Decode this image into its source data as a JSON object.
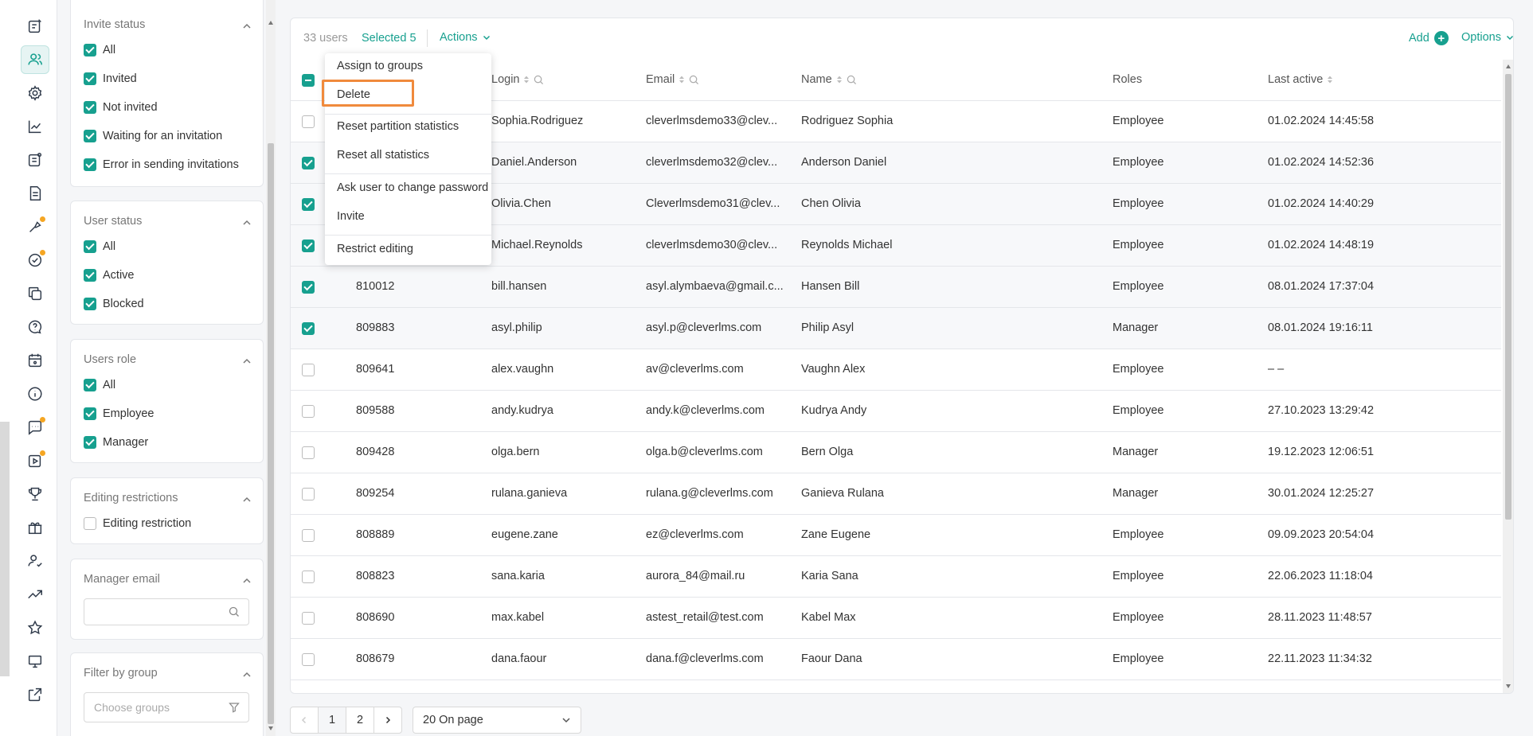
{
  "rail": {
    "icons": [
      "tasks-icon",
      "users-icon",
      "settings-icon",
      "analytics-icon",
      "reports-icon",
      "document-icon",
      "skills-icon",
      "assessment-icon",
      "copy-icon",
      "feedback-icon",
      "calendar-icon",
      "info-icon",
      "chat-icon",
      "video-icon",
      "trophy-icon",
      "gift-icon",
      "user-check-icon",
      "trend-icon",
      "star-icon",
      "monitor-icon",
      "external-link-icon"
    ],
    "active": "users-icon",
    "accent": "#17a08f",
    "badge_color": "#f5a623"
  },
  "filters": {
    "invite_status": {
      "title": "Invite status",
      "options": [
        {
          "label": "All",
          "checked": true
        },
        {
          "label": "Invited",
          "checked": true
        },
        {
          "label": "Not invited",
          "checked": true
        },
        {
          "label": "Waiting for an invitation",
          "checked": true
        },
        {
          "label": "Error in sending invitations",
          "checked": true
        }
      ]
    },
    "user_status": {
      "title": "User status",
      "options": [
        {
          "label": "All",
          "checked": true
        },
        {
          "label": "Active",
          "checked": true
        },
        {
          "label": "Blocked",
          "checked": true
        }
      ]
    },
    "users_role": {
      "title": "Users role",
      "options": [
        {
          "label": "All",
          "checked": true
        },
        {
          "label": "Employee",
          "checked": true
        },
        {
          "label": "Manager",
          "checked": true
        }
      ]
    },
    "editing_restrictions": {
      "title": "Editing restrictions",
      "options": [
        {
          "label": "Editing restriction",
          "checked": false
        }
      ]
    },
    "manager_email": {
      "title": "Manager email",
      "value": ""
    },
    "filter_by_group": {
      "title": "Filter by group",
      "placeholder": "Choose groups"
    }
  },
  "toolbar": {
    "count": "33 users",
    "selected": "Selected 5",
    "actions": "Actions",
    "add": "Add",
    "options": "Options"
  },
  "columns": {
    "login": "Login",
    "email": "Email",
    "name": "Name",
    "roles": "Roles",
    "last_active": "Last active"
  },
  "rows": [
    {
      "id": "",
      "login": "Sophia.Rodriguez",
      "email": "cleverlmsdemo33@clev...",
      "name": "Rodriguez Sophia",
      "role": "Employee",
      "last_active": "01.02.2024 14:45:58",
      "checked": false
    },
    {
      "id": "",
      "login": "Daniel.Anderson",
      "email": "cleverlmsdemo32@clev...",
      "name": "Anderson Daniel",
      "role": "Employee",
      "last_active": "01.02.2024 14:52:36",
      "checked": true
    },
    {
      "id": "",
      "login": "Olivia.Chen",
      "email": "Cleverlmsdemo31@clev...",
      "name": "Chen Olivia",
      "role": "Employee",
      "last_active": "01.02.2024 14:40:29",
      "checked": true
    },
    {
      "id": "",
      "login": "Michael.Reynolds",
      "email": "cleverlmsdemo30@clev...",
      "name": "Reynolds Michael",
      "role": "Employee",
      "last_active": "01.02.2024 14:48:19",
      "checked": true
    },
    {
      "id": "810012",
      "login": "bill.hansen",
      "email": "asyl.alymbaeva@gmail.c...",
      "name": "Hansen Bill",
      "role": "Employee",
      "last_active": "08.01.2024 17:37:04",
      "checked": true
    },
    {
      "id": "809883",
      "login": "asyl.philip",
      "email": "asyl.p@cleverlms.com",
      "name": "Philip Asyl",
      "role": "Manager",
      "last_active": "08.01.2024 19:16:11",
      "checked": true
    },
    {
      "id": "809641",
      "login": "alex.vaughn",
      "email": "av@cleverlms.com",
      "name": "Vaughn Alex",
      "role": "Employee",
      "last_active": "– –",
      "checked": false
    },
    {
      "id": "809588",
      "login": "andy.kudrya",
      "email": "andy.k@cleverlms.com",
      "name": "Kudrya Andy",
      "role": "Employee",
      "last_active": "27.10.2023 13:29:42",
      "checked": false
    },
    {
      "id": "809428",
      "login": "olga.bern",
      "email": "olga.b@cleverlms.com",
      "name": "Bern Olga",
      "role": "Manager",
      "last_active": "19.12.2023 12:06:51",
      "checked": false
    },
    {
      "id": "809254",
      "login": "rulana.ganieva",
      "email": "rulana.g@cleverlms.com",
      "name": "Ganieva Rulana",
      "role": "Manager",
      "last_active": "30.01.2024 12:25:27",
      "checked": false
    },
    {
      "id": "808889",
      "login": "eugene.zane",
      "email": "ez@cleverlms.com",
      "name": "Zane Eugene",
      "role": "Employee",
      "last_active": "09.09.2023 20:54:04",
      "checked": false
    },
    {
      "id": "808823",
      "login": "sana.karia",
      "email": "aurora_84@mail.ru",
      "name": "Karia Sana",
      "role": "Employee",
      "last_active": "22.06.2023 11:18:04",
      "checked": false
    },
    {
      "id": "808690",
      "login": "max.kabel",
      "email": "astest_retail@test.com",
      "name": "Kabel Max",
      "role": "Employee",
      "last_active": "28.11.2023 11:48:57",
      "checked": false
    },
    {
      "id": "808679",
      "login": "dana.faour",
      "email": "dana.f@cleverlms.com",
      "name": "Faour Dana",
      "role": "Employee",
      "last_active": "22.11.2023 11:34:32",
      "checked": false
    }
  ],
  "actions_menu": {
    "items": [
      "Assign to groups",
      "Delete",
      "Reset partition statistics",
      "Reset all statistics",
      "Ask user to change password",
      "Invite",
      "Restrict editing"
    ],
    "highlighted": "Delete",
    "highlight_color": "#f08a3c"
  },
  "pagination": {
    "pages": [
      "1",
      "2"
    ],
    "current": "1",
    "per_page": "20 On page"
  }
}
